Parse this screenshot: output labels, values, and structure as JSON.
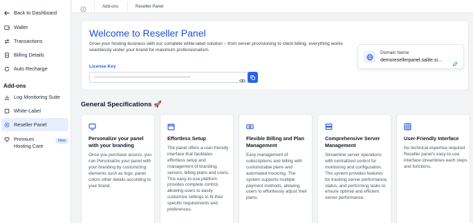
{
  "sidebar": {
    "back": "Back to Dashboard",
    "items": [
      "Wallet",
      "Transactions",
      "Billing Details",
      "Auto Recharge"
    ],
    "section": "Add-ons",
    "addons": [
      "Log Monitoring Suite",
      "White-Label",
      "Reseller Panel",
      "Premium Hosting Care"
    ],
    "new_badge": "New"
  },
  "breadcrumb": [
    "Add-ons",
    "Reseller Panel"
  ],
  "hero": {
    "title": "Welcome to Reseller Panel",
    "description": "Grow your hosting business with our complete white-label solution – from server provisioning to client billing, everything works seamlessly under your brand for maximum professionalism.",
    "license_label": "License Key",
    "license_value": "----------------------------------------------------------------------------------"
  },
  "domain": {
    "label": "Domain Name",
    "value": "demoresellerpanel.salite.si..."
  },
  "specs": {
    "title": "General Specifications 🚀",
    "cards": [
      {
        "title": "Personalize your panel with your branding",
        "desc": "Once you purchase access, you can Personalize your panel with your branding by customizing elements such as logo, panel colors other details according to your brand.",
        "icon": "monitor-icon"
      },
      {
        "title": "Effortless Setup",
        "desc": "The panel offers a user-friendly interface that facilitates effortless setup and management of branding, servers, billing plans and users. This easy-to-use platform provides complete control, allowing users to easily customize settings to fit their specific requirements and preferences.",
        "icon": "calendar-icon"
      },
      {
        "title": "Flexible Billing and Plan Management",
        "desc": "Easy management of subscriptions and billing with customizable plans and automated invoicing. The system supports multiple payment methods, allowing users to effortlessly adjust their plans.",
        "icon": "money-icon"
      },
      {
        "title": "Comprehensive Server Management",
        "desc": "Streamline server operations with centralized control for monitoring and configuration. The system provides features for tracking server performance, status, and performing tasks to ensure optimal and efficient server performance.",
        "icon": "server-icon"
      },
      {
        "title": "User-Friendly Interface",
        "desc": "No technical expertise required. Reseller panel's easy-to-use interface streamlines each steps and functions.",
        "icon": "grid-icon"
      }
    ]
  },
  "colors": {
    "accent": "#2563eb",
    "title": "#1d4ed8",
    "active_bg": "#e8eefc"
  }
}
